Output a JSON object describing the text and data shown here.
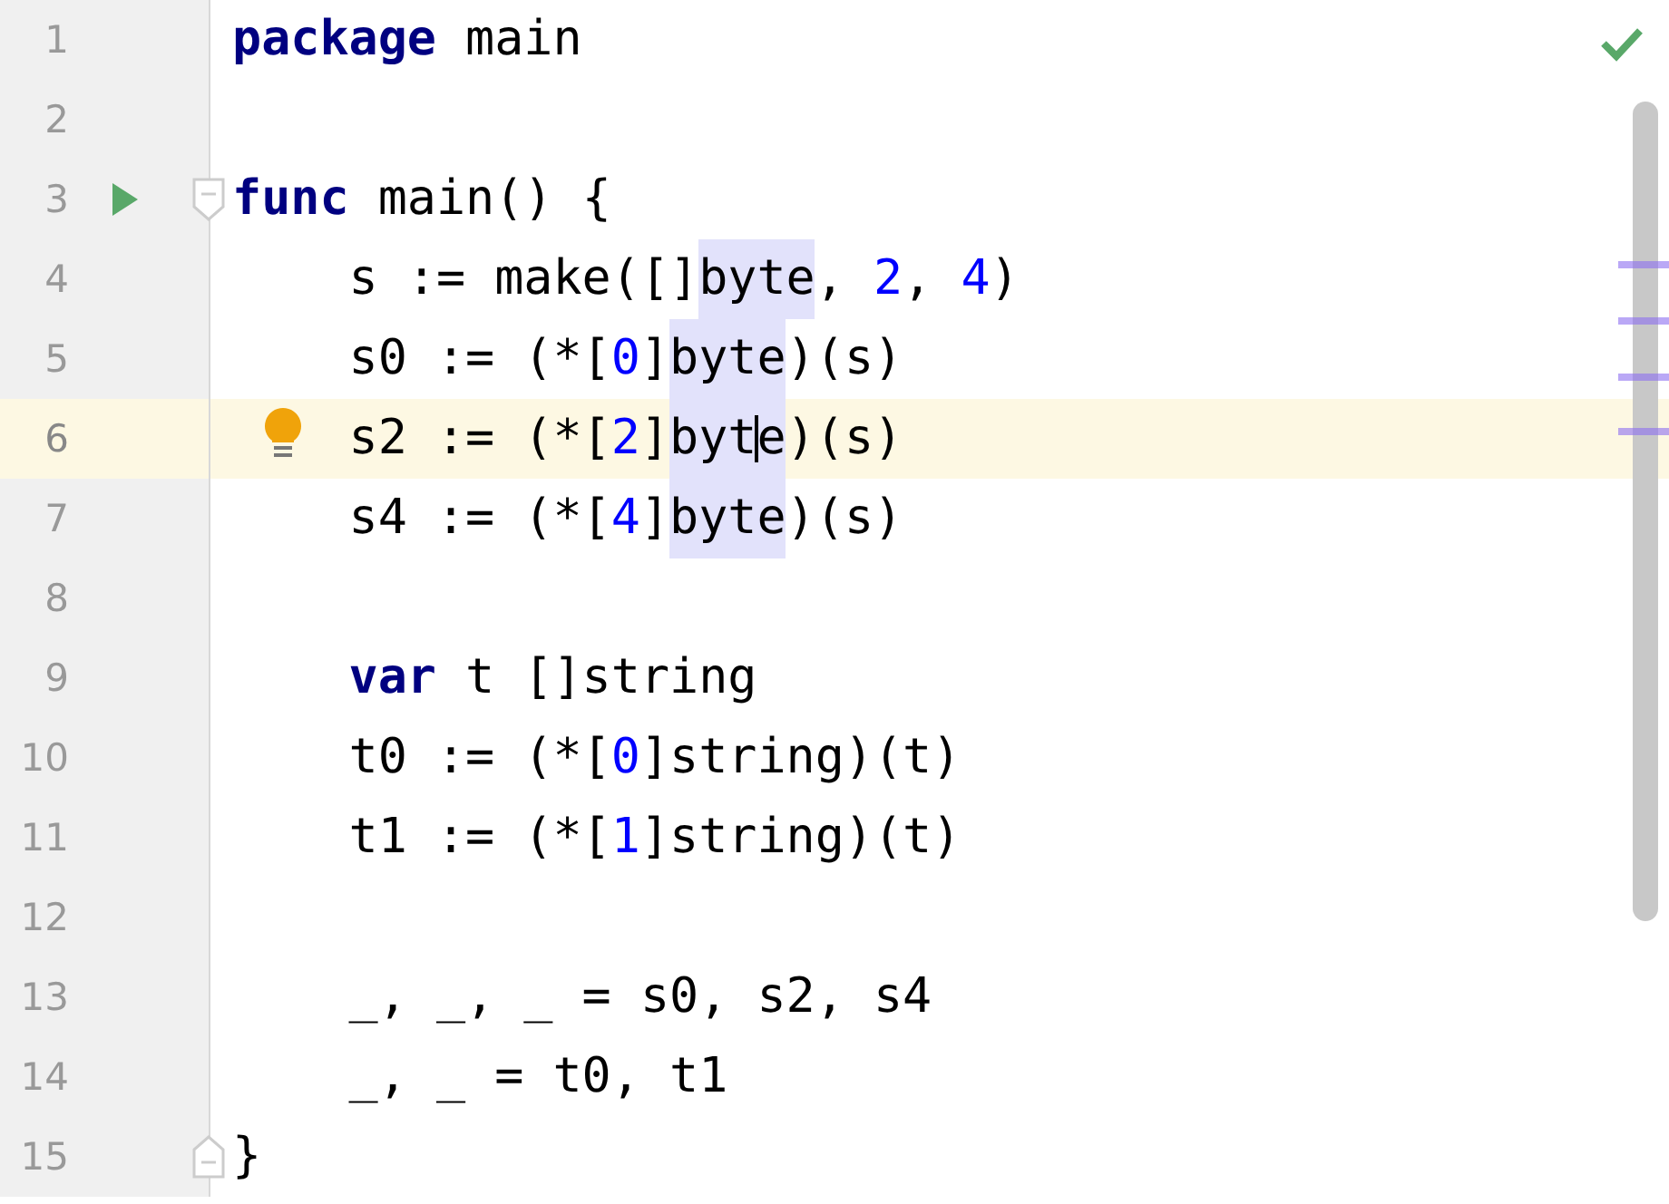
{
  "inspection_passed": true,
  "lines": [
    {
      "number": "1",
      "current": false,
      "indented": false,
      "tokens": [
        {
          "text": "package",
          "kind": "keyword",
          "highlighted": false
        },
        {
          "text": " main",
          "kind": "plain",
          "highlighted": false
        }
      ]
    },
    {
      "number": "2",
      "current": false
    },
    {
      "number": "3",
      "current": false,
      "indented": false,
      "run": true,
      "fold": {
        "kind": "start"
      },
      "tokens": [
        {
          "text": "func",
          "kind": "keyword",
          "highlighted": false
        },
        {
          "text": " main() {",
          "kind": "plain",
          "highlighted": false
        }
      ]
    },
    {
      "number": "4",
      "current": false,
      "indented": true,
      "tokens": [
        {
          "text": "s := make([]",
          "kind": "plain",
          "highlighted": false
        },
        {
          "text": "byte",
          "kind": "plain",
          "highlighted": true
        },
        {
          "text": ", ",
          "kind": "plain",
          "highlighted": false
        },
        {
          "text": "2",
          "kind": "number",
          "highlighted": false
        },
        {
          "text": ", ",
          "kind": "plain",
          "highlighted": false
        },
        {
          "text": "4",
          "kind": "number",
          "highlighted": false
        },
        {
          "text": ")",
          "kind": "plain",
          "highlighted": false
        }
      ]
    },
    {
      "number": "5",
      "current": false,
      "indented": true,
      "tokens": [
        {
          "text": "s0 := (*[",
          "kind": "plain",
          "highlighted": false
        },
        {
          "text": "0",
          "kind": "number",
          "highlighted": false
        },
        {
          "text": "]",
          "kind": "plain",
          "highlighted": false
        },
        {
          "text": "byte",
          "kind": "plain",
          "highlighted": true
        },
        {
          "text": ")(s)",
          "kind": "plain",
          "highlighted": false
        }
      ]
    },
    {
      "number": "6",
      "current": true,
      "indented": true,
      "bulb": true,
      "tokens": [
        {
          "text": "s2 := (*[",
          "kind": "plain",
          "highlighted": false
        },
        {
          "text": "2",
          "kind": "number",
          "highlighted": false
        },
        {
          "text": "]",
          "kind": "plain",
          "highlighted": false
        },
        {
          "text": "byt",
          "kind": "plain",
          "highlighted": true
        },
        {
          "text": "e",
          "kind": "plain",
          "highlighted": true,
          "caret_before": true
        },
        {
          "text": ")(s)",
          "kind": "plain",
          "highlighted": false
        }
      ]
    },
    {
      "number": "7",
      "current": false,
      "indented": true,
      "tokens": [
        {
          "text": "s4 := (*[",
          "kind": "plain",
          "highlighted": false
        },
        {
          "text": "4",
          "kind": "number",
          "highlighted": false
        },
        {
          "text": "]",
          "kind": "plain",
          "highlighted": false
        },
        {
          "text": "byte",
          "kind": "plain",
          "highlighted": true
        },
        {
          "text": ")(s)",
          "kind": "plain",
          "highlighted": false
        }
      ]
    },
    {
      "number": "8",
      "current": false
    },
    {
      "number": "9",
      "current": false,
      "indented": true,
      "tokens": [
        {
          "text": "var",
          "kind": "keyword",
          "highlighted": false
        },
        {
          "text": " t []string",
          "kind": "plain",
          "highlighted": false
        }
      ]
    },
    {
      "number": "10",
      "current": false,
      "indented": true,
      "tokens": [
        {
          "text": "t0 := (*[",
          "kind": "plain",
          "highlighted": false
        },
        {
          "text": "0",
          "kind": "number",
          "highlighted": false
        },
        {
          "text": "]string)(t)",
          "kind": "plain",
          "highlighted": false
        }
      ]
    },
    {
      "number": "11",
      "current": false,
      "indented": true,
      "tokens": [
        {
          "text": "t1 := (*[",
          "kind": "plain",
          "highlighted": false
        },
        {
          "text": "1",
          "kind": "number",
          "highlighted": false
        },
        {
          "text": "]string)(t)",
          "kind": "plain",
          "highlighted": false
        }
      ]
    },
    {
      "number": "12",
      "current": false
    },
    {
      "number": "13",
      "current": false,
      "indented": true,
      "tokens": [
        {
          "text": "_, _, _ = s0, s2, s4",
          "kind": "plain",
          "highlighted": false
        }
      ]
    },
    {
      "number": "14",
      "current": false,
      "indented": true,
      "tokens": [
        {
          "text": "_, _ = t0, t1",
          "kind": "plain",
          "highlighted": false
        }
      ]
    },
    {
      "number": "15",
      "current": false,
      "indented": false,
      "fold": {
        "kind": "end"
      },
      "tokens": [
        {
          "text": "}",
          "kind": "plain",
          "highlighted": false
        }
      ]
    }
  ]
}
